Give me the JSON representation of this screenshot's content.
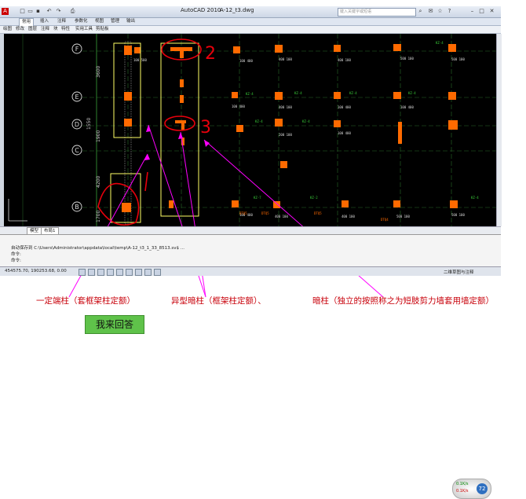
{
  "window": {
    "app_title": "AutoCAD 2010",
    "file_title": "A-12_t3.dwg",
    "search_placeholder": "键入关键字或短语"
  },
  "ribbon_tabs": [
    "常用",
    "插入",
    "注释",
    "参数化",
    "视图",
    "管理",
    "输出"
  ],
  "tool_row": [
    "绘图",
    "修改",
    "图层",
    "注释",
    "块",
    "特性",
    "实用工具",
    "剪贴板"
  ],
  "canvas": {
    "grid_labels": [
      "F",
      "E",
      "D",
      "C",
      "B"
    ],
    "dimensions": [
      "3600",
      "1550",
      "1900",
      "4200",
      "1700"
    ],
    "callouts": [
      "2",
      "3"
    ]
  },
  "layout_tabs": [
    "模型",
    "布局1"
  ],
  "command": {
    "line1": "自动保存到 C:\\Users\\Administrator\\appdata\\local\\temp\\A-12_t3_1_33_8513.sv$ ...",
    "line2": "命令:",
    "line3": "命令:"
  },
  "status": {
    "coords": "454575.70, 190253.68, 0.00",
    "workspace": "二维草图与注释"
  },
  "bubble": {
    "value": "72",
    "rate1": "0.1K/s",
    "rate2": "0.1K/s"
  },
  "annotations": {
    "note1": "一定端柱（套框架柱定额）",
    "note2": "异型暗柱（框架柱定额）、",
    "note3": "暗柱（独立的按照称之为短肢剪力墙套用墙定额）"
  },
  "answer_button": "我来回答",
  "colors": {
    "accent_red": "#c8000a",
    "magenta": "#ff00ff",
    "column_orange": "#ff6a00",
    "highlight_yellow": "#ffff66"
  }
}
